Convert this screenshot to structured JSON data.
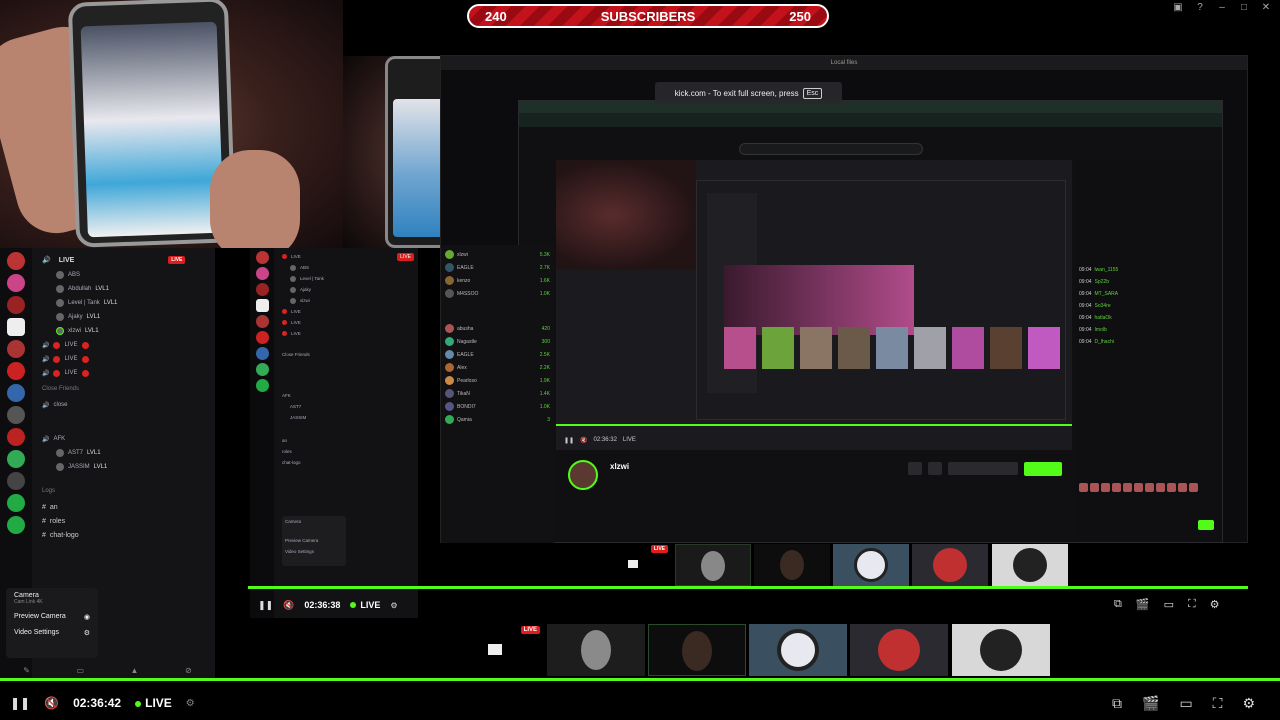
{
  "subscriber_goal": {
    "current": "240",
    "label": "SUBSCRIBERS",
    "target": "250"
  },
  "fullscreen_toast": {
    "text": "kick.com - To exit full screen, press",
    "key": "Esc"
  },
  "discord_left": {
    "voice_channels": [
      {
        "label": "LIVE",
        "members": [
          {
            "name": "ABS"
          },
          {
            "name": "Abdullah"
          },
          {
            "name": "Level | Tank"
          },
          {
            "name": "Ajaky"
          },
          {
            "name": "xlzwi"
          }
        ]
      },
      {
        "label": "LIVE",
        "members": []
      },
      {
        "label": "LIVE",
        "members": []
      },
      {
        "label": "LIVE",
        "members": []
      }
    ],
    "close_friends_section": "Close Friends",
    "close_channel": "close",
    "afk_channel": "AFK",
    "afk_members": [
      "AST7",
      "JASSIM"
    ],
    "logs_section": "Logs",
    "text_channels": [
      "an",
      "roles",
      "chat-logo"
    ],
    "member_tag": "LVL1",
    "live_badge": "LIVE"
  },
  "camera_menu": {
    "title": "Camera",
    "subtitle": "Cam Link 4K",
    "preview": "Preview Camera",
    "settings": "Video Settings"
  },
  "discord_mid": {
    "members": [
      "ABS",
      "Level | Tank",
      "Ajaky",
      "xlzwi"
    ],
    "live_badge": "LIVE",
    "menu": {
      "title": "Camera",
      "preview": "Preview Camera",
      "settings": "Video Settings"
    }
  },
  "kick_sidebar": {
    "following": [
      {
        "name": "xlzwi",
        "viewers": "5.3K"
      },
      {
        "name": "EAGLE",
        "viewers": "2.7K"
      },
      {
        "name": "kenzo",
        "viewers": "1.6K"
      },
      {
        "name": "M4SSOO",
        "viewers": "1.0K"
      },
      {
        "name": "abusha",
        "viewers": "420"
      },
      {
        "name": "Nagastle",
        "viewers": "300"
      },
      {
        "name": "EAGLE",
        "viewers": "2.5K"
      },
      {
        "name": "Alex",
        "viewers": "2.2K"
      },
      {
        "name": "Pearloso",
        "viewers": "1.9K"
      },
      {
        "name": "TikaN",
        "viewers": "1.4K"
      },
      {
        "name": "BONDI7",
        "viewers": "1.0K"
      },
      {
        "name": "Qamia",
        "viewers": "3"
      }
    ]
  },
  "kick_stream": {
    "streamer": "xlzwi",
    "inner_time": "02:36:32",
    "inner_live": "LIVE"
  },
  "kick_chat": {
    "messages": [
      {
        "time": "09:04",
        "user": "lwan_1155",
        "text": ""
      },
      {
        "time": "09:04",
        "user": "Sp22b",
        "text": ""
      },
      {
        "time": "09:04",
        "user": "MT_SARA",
        "text": ""
      },
      {
        "time": "09:04",
        "user": "So34re",
        "text": ""
      },
      {
        "time": "09:04",
        "user": "hatlaOk",
        "text": ""
      },
      {
        "time": "09:04",
        "user": "Imolb",
        "text": ""
      },
      {
        "time": "09:04",
        "user": "D_lhachi",
        "text": ""
      }
    ]
  },
  "mid_player": {
    "time": "02:36:38",
    "live": "LIVE"
  },
  "main_player": {
    "time": "02:36:42",
    "live": "LIVE"
  },
  "preview_strip": {
    "live_badge": "LIVE"
  },
  "colors": {
    "kick_green": "#53fc18",
    "live_red": "#e21b1b",
    "goal_red": "#c3121b"
  }
}
